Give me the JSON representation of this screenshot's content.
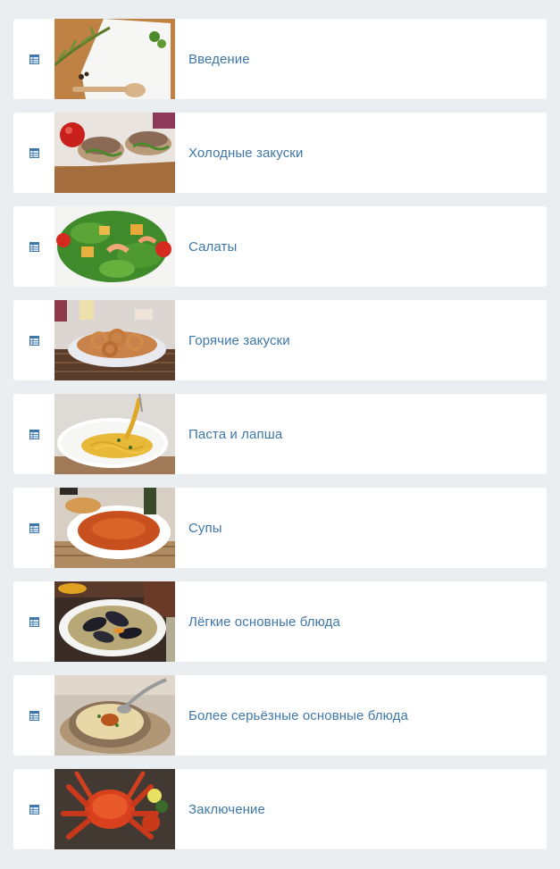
{
  "colors": {
    "background": "#ebeef1",
    "card": "#ffffff",
    "label": "#3f78a8",
    "icon": "#3f78a8"
  },
  "chapters": [
    {
      "icon": "list-icon",
      "label": "Введение",
      "thumb": "herbs-and-spoon-photo"
    },
    {
      "icon": "list-icon",
      "label": "Холодные закуски",
      "thumb": "cold-appetizers-photo"
    },
    {
      "icon": "list-icon",
      "label": "Салаты",
      "thumb": "salad-photo"
    },
    {
      "icon": "list-icon",
      "label": "Горячие закуски",
      "thumb": "fried-calamari-photo"
    },
    {
      "icon": "list-icon",
      "label": "Паста и лапша",
      "thumb": "pasta-photo"
    },
    {
      "icon": "list-icon",
      "label": "Супы",
      "thumb": "soup-photo"
    },
    {
      "icon": "list-icon",
      "label": "Лёгкие основные блюда",
      "thumb": "mussels-photo"
    },
    {
      "icon": "list-icon",
      "label": "Более серьёзные основные блюда",
      "thumb": "cream-soup-photo"
    },
    {
      "icon": "list-icon",
      "label": "Заключение",
      "thumb": "crab-photo"
    }
  ]
}
